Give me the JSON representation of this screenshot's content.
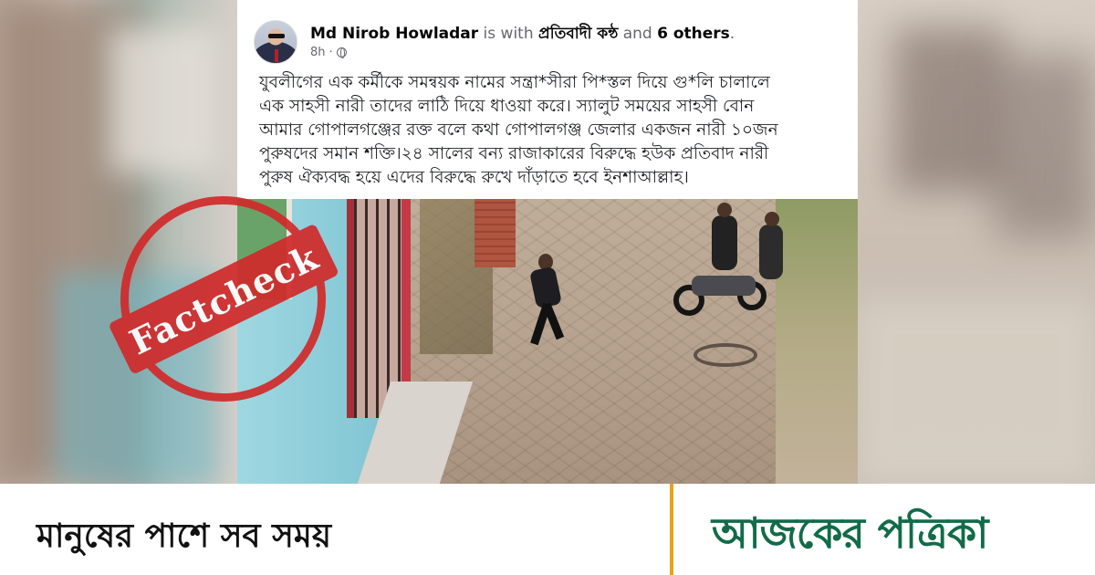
{
  "post": {
    "author": "Md Nirob Howladar",
    "with_text": " is with ",
    "group": "প্রতিবাদী কন্ঠ",
    "and_text": " and ",
    "others": "6 others",
    "period": ".",
    "time": "8h",
    "dot": "·",
    "lines": [
      "যুবলীগের এক কর্মীকে সমন্বয়ক নামের সন্ত্রা*সীরা পি*স্তল দিয়ে গু*লি চালালে",
      "এক সাহসী নারী তাদের লাঠি দিয়ে ধাওয়া করে। স্যালুট সময়ের সাহসী বোন",
      "আমার গোপালগঞ্জের রক্ত বলে কথা গোপালগঞ্জ জেলার একজন নারী ১০জন",
      "পুরুষদের সমান শক্তি।২৪ সালের  বন্য রাজাকারের বিরুদ্ধে হউক প্রতিবাদ নারী",
      "পুরুষ ঐক্যবদ্ধ হয়ে এদের বিরুদ্ধে রুখে দাঁড়াতে হবে ইনশাআল্লাহ।"
    ]
  },
  "stamp": {
    "label": "Factcheck",
    "color": "#d12a2a"
  },
  "banner": {
    "tagline": "মানুষের পাশে সব সময়",
    "brand": "আজকের পত্রিকা",
    "brand_color": "#126b4a",
    "divider_color": "#e8a21a"
  }
}
